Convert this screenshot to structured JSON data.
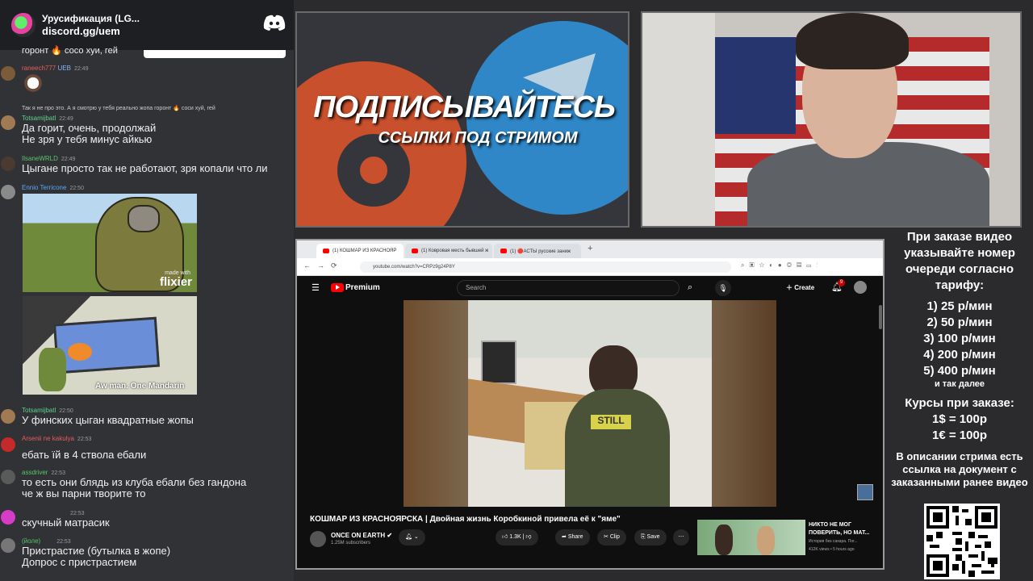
{
  "chat_header": {
    "server_name": "Урусификация (LG...",
    "invite": "discord.gg/uem"
  },
  "chat": [
    {
      "text_top_cut": "горонт 🔥 сосо хуи, гей"
    },
    {
      "user": "raneech777",
      "badge": "UEB",
      "time": "22:49"
    },
    {
      "reply": "Так я не про это. А я смотрю у тебя реально жопа горонт 🔥 соси хуй, гей"
    },
    {
      "user": "Totsamijbatl",
      "time": "22:49",
      "lines": [
        "Да горит, очень, продолжай",
        "Не зря у тебя минус айкью"
      ]
    },
    {
      "user": "IlsaneWRLD",
      "time": "22:49",
      "lines": [
        "Цыгане просто так не работают, зря копали что ли"
      ]
    },
    {
      "user": "Ennio Terricone",
      "time": "22:50",
      "meme1_caption": "flixier",
      "meme1_small": "made with",
      "meme2_caption": "Aw man. One Mandarin"
    },
    {
      "user": "Totsamijbatl",
      "time": "22:50",
      "lines": [
        "У финских цыган квадратные жопы"
      ]
    },
    {
      "user": "Arsenii ne kakulya",
      "time": "22:53",
      "lines": [
        "ебать їй в 4 ствола ебали"
      ]
    },
    {
      "user": "assdriver",
      "time": "22:53",
      "lines": [
        "то есть они блядь из клуба ебали без гандона",
        "че ж вы парни творите то"
      ]
    },
    {
      "user": "",
      "time": "22:53",
      "lines": [
        "скучный матрасик"
      ]
    },
    {
      "user": "(йоле)",
      "time": "22:53",
      "lines": [
        "Пристрастие (бутылка в жопе)",
        "Допрос с пристрастием"
      ]
    }
  ],
  "promo": {
    "line1": "ПОДПИСЫВАЙТЕСЬ",
    "line2": "ССЫЛКИ ПОД СТРИМОМ"
  },
  "browser": {
    "tabs": [
      "(1) КОШМАР ИЗ КРАСНОЯР",
      "(1) Ковровая месть бывшей ж",
      "(1) 🔴АСТЫ русские заниж"
    ],
    "url": "youtube.com/watch?v=CRPz9g24P8Y",
    "logo": "Premium",
    "search_placeholder": "Search",
    "create": "Create",
    "notif_count": "9",
    "video_title": "КОШМАР ИЗ КРАСНОЯРСКА | Двойная жизнь Коробкиной привела её к \"яме\"",
    "channel": "ONCE ON EARTH",
    "subs": "1.25M subscribers",
    "likes": "1.3K",
    "share": "Share",
    "clip": "Clip",
    "save": "Save",
    "shirt_text": "STILL",
    "rec_title": "НИКТО НЕ МОГ ПОВЕРИТЬ, НО МАТ...",
    "rec_channel": "История без сахара. Пог...",
    "rec_meta": "412K views • 5 hours ago"
  },
  "info": {
    "l1": "При заказе видео указывайте номер очереди согласно тарифу:",
    "rates": [
      "1) 25 р/мин",
      "2) 50 р/мин",
      "3) 100 р/мин",
      "4) 200 р/мин",
      "5) 400 р/мин"
    ],
    "etc": "и так далее",
    "courses_title": "Курсы при заказе:",
    "course1": "1$ = 100р",
    "course2": "1€ = 100р",
    "desc": "В описании стрима есть ссылка на документ с заказанными ранее видео"
  }
}
